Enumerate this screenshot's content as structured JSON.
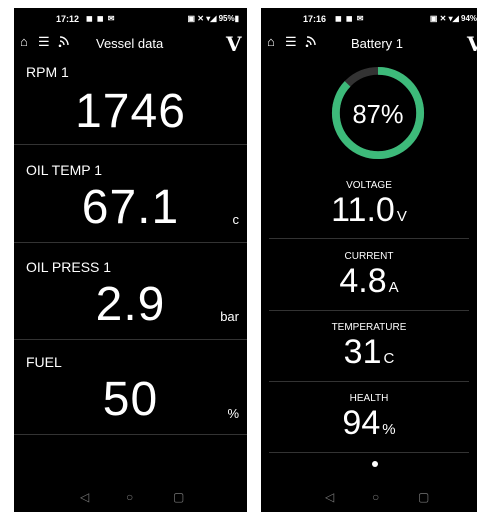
{
  "left": {
    "status": {
      "time": "17:12",
      "notif": "◼ ◼ ✉",
      "sys": "▣ ✕ ▾◢ 95%▮"
    },
    "header": {
      "title": "Vessel data",
      "logo": "V"
    },
    "tiles": [
      {
        "label": "RPM 1",
        "value": "1746",
        "unit": ""
      },
      {
        "label": "OIL TEMP 1",
        "value": "67.1",
        "unit": "c"
      },
      {
        "label": "OIL PRESS 1",
        "value": "2.9",
        "unit": "bar"
      },
      {
        "label": "FUEL",
        "value": "50",
        "unit": "%"
      }
    ]
  },
  "right": {
    "status": {
      "time": "17:16",
      "notif": "◼ ◼ ✉",
      "sys": "▣ ✕ ▾◢ 94%"
    },
    "header": {
      "title": "Battery 1",
      "logo": "V"
    },
    "gauge": {
      "percent": 87,
      "label": "87%",
      "color": "#3dba7a",
      "track": "#333333"
    },
    "readings": [
      {
        "label": "VOLTAGE",
        "value": "11.0",
        "unit": "V"
      },
      {
        "label": "CURRENT",
        "value": "4.8",
        "unit": "A"
      },
      {
        "label": "TEMPERATURE",
        "value": "31",
        "unit": "C"
      },
      {
        "label": "HEALTH",
        "value": "94",
        "unit": "%"
      }
    ]
  },
  "icons": {
    "home": "home-icon",
    "menu": "menu-icon",
    "feed": "rss-icon",
    "back": "back-icon",
    "home_nav": "home-nav-icon",
    "recents": "recents-icon"
  }
}
